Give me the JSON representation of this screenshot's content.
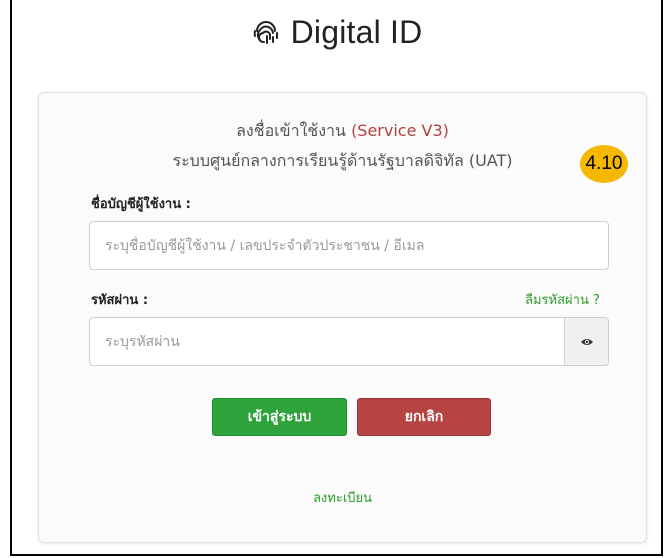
{
  "brand": {
    "title": "Digital ID",
    "icon": "fingerprint-icon"
  },
  "header": {
    "line1_prefix": "ลงชื่อเข้าใช้งาน ",
    "line1_accent": "(Service V3)",
    "line2": "ระบบศูนย์กลางการเรียนรู้ด้านรัฐบาลดิจิทัล (UAT)"
  },
  "badge": {
    "text": "4.10"
  },
  "username": {
    "label": "ชื่อบัญชีผู้ใช้งาน :",
    "placeholder": "ระบุชื่อบัญชีผู้ใช้งาน / เลขประจำตัวประชาชน / อีเมล"
  },
  "password": {
    "label": "รหัสผ่าน :",
    "placeholder": "ระบุรหัสผ่าน",
    "forgot_link": "ลืมรหัสผ่าน ?",
    "toggle_icon": "eye-icon"
  },
  "buttons": {
    "login": "เข้าสู่ระบบ",
    "cancel": "ยกเลิก"
  },
  "register_link": "ลงทะเบียน",
  "colors": {
    "accent_red": "#b0413e",
    "login_green": "#2fa33b",
    "cancel_red": "#b54442",
    "link_green": "#2e9a2e",
    "badge_yellow": "#f5b800"
  }
}
